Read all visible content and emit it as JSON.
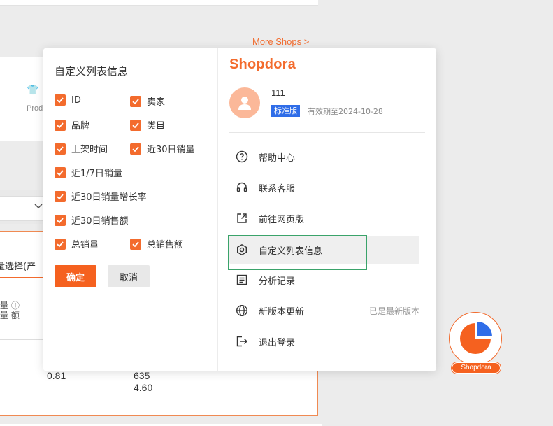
{
  "colors": {
    "accent": "#f36b2d",
    "confirm_button": "#f5611f",
    "plan_badge": "#2f6de8",
    "highlight": "#3aa36a"
  },
  "background": {
    "more_shops": "More Shops >",
    "product_label": "Prod",
    "bulk_select": "量选择(产",
    "column_header": "量 ⓘ 量 额",
    "values": [
      "0.81",
      "635",
      "4.60"
    ]
  },
  "custom_columns": {
    "title": "自定义列表信息",
    "options": [
      {
        "label": "ID",
        "checked": true
      },
      {
        "label": "卖家",
        "checked": true
      },
      {
        "label": "品牌",
        "checked": true
      },
      {
        "label": "类目",
        "checked": true
      },
      {
        "label": "上架时间",
        "checked": true
      },
      {
        "label": "近30日销量",
        "checked": true
      },
      {
        "label": "近1/7日销量",
        "checked": true
      },
      {
        "label": "近30日销量增长率",
        "checked": true
      },
      {
        "label": "近30日销售额",
        "checked": true
      },
      {
        "label": "总销量",
        "checked": true
      },
      {
        "label": "总销售额",
        "checked": true
      }
    ],
    "confirm_label": "确定",
    "cancel_label": "取消"
  },
  "account": {
    "brand": "Shopdora",
    "username": "111",
    "plan": "标准版",
    "expiry": "有效期至2024-10-28"
  },
  "menu": {
    "items": [
      {
        "label": "帮助中心",
        "icon": "help-circle-icon"
      },
      {
        "label": "联系客服",
        "icon": "headset-icon"
      },
      {
        "label": "前往网页版",
        "icon": "external-link-icon"
      },
      {
        "label": "自定义列表信息",
        "icon": "settings-hexagon-icon"
      },
      {
        "label": "分析记录",
        "icon": "document-list-icon"
      },
      {
        "label": "新版本更新",
        "icon": "globe-icon",
        "aside": "已是最新版本"
      },
      {
        "label": "退出登录",
        "icon": "logout-icon"
      }
    ]
  },
  "float_widget": {
    "label": "Shopdora"
  }
}
